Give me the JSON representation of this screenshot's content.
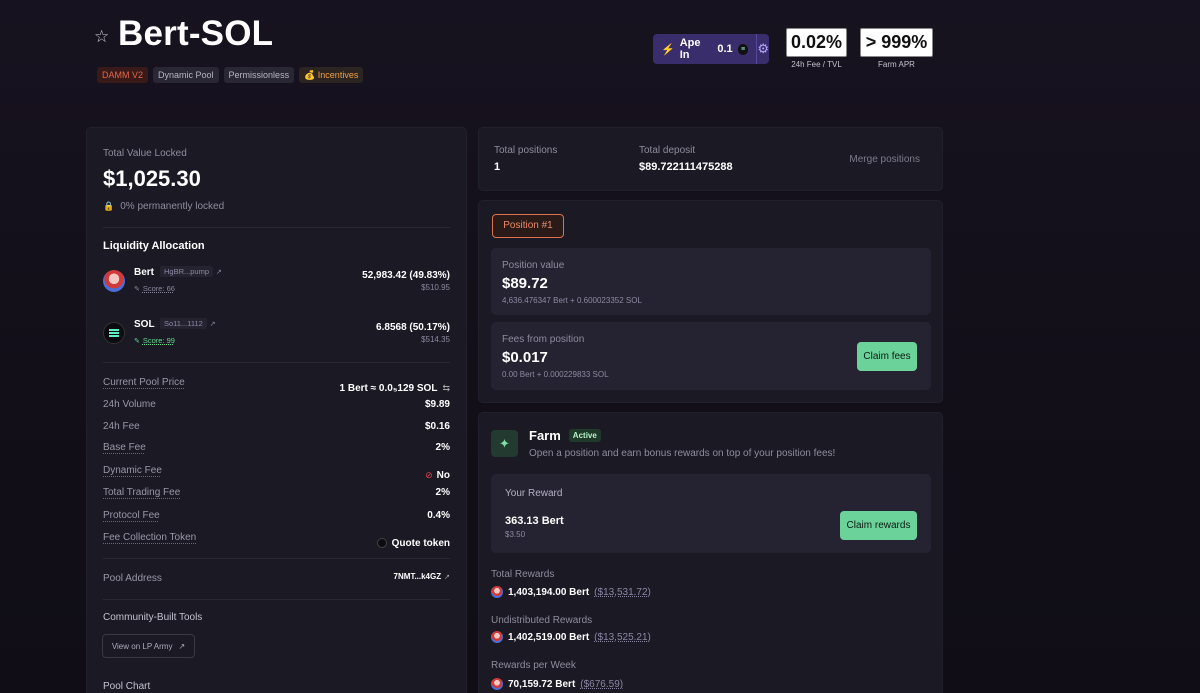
{
  "header": {
    "title": "Bert-SOL",
    "tags": [
      "DAMM V2",
      "Dynamic Pool",
      "Permissionless",
      "Incentives"
    ],
    "ape_label": "Ape In",
    "ape_amount": "0.1",
    "fee_tvl_value": "0.02%",
    "fee_tvl_caption": "24h Fee / TVL",
    "farm_apr_value": "> 999%",
    "farm_apr_caption": "Farm APR"
  },
  "left": {
    "tvl_label": "Total Value Locked",
    "tvl_value": "$1,025.30",
    "locked_text": "0% permanently locked",
    "alloc_title": "Liquidity Allocation",
    "tokens": [
      {
        "symbol": "Bert",
        "address": "HgBR...pump",
        "score": "Score: 66",
        "amount": "52,983.42 (49.83%)",
        "usd": "$510.95"
      },
      {
        "symbol": "SOL",
        "address": "So11...1112",
        "score": "Score: 99",
        "amount": "6.8568 (50.17%)",
        "usd": "$514.35"
      }
    ],
    "rows": [
      {
        "label": "Current Pool Price",
        "value": "1 Bert ≈ 0.0₅129 SOL"
      },
      {
        "label": "24h Volume",
        "value": "$9.89"
      },
      {
        "label": "24h Fee",
        "value": "$0.16"
      },
      {
        "label": "Base Fee",
        "value": "2%"
      },
      {
        "label": "Dynamic Fee",
        "value": "No"
      },
      {
        "label": "Total Trading Fee",
        "value": "2%"
      },
      {
        "label": "Protocol Fee",
        "value": "0.4%"
      },
      {
        "label": "Fee Collection Token",
        "value": "Quote token"
      }
    ],
    "pool_address_label": "Pool Address",
    "pool_address_value": "7NMT...k4GZ",
    "community_title": "Community-Built Tools",
    "lp_army_button": "View on LP Army",
    "pool_chart_title": "Pool Chart"
  },
  "positions_summary": {
    "total_positions_label": "Total positions",
    "total_positions_value": "1",
    "total_deposit_label": "Total deposit",
    "total_deposit_value": "$89.722111475288",
    "merge_label": "Merge positions"
  },
  "position": {
    "badge": "Position #1",
    "value_label": "Position value",
    "value": "$89.72",
    "value_detail": "4,636.476347 Bert + 0.600023352 SOL",
    "fees_label": "Fees from position",
    "fees_value": "$0.017",
    "fees_detail": "0.00 Bert + 0.000229833 SOL",
    "claim_fees": "Claim fees"
  },
  "farm": {
    "title": "Farm",
    "status": "Active",
    "description": "Open a position and earn bonus rewards on top of your position fees!",
    "your_reward_label": "Your Reward",
    "your_reward_value": "363.13 Bert",
    "your_reward_usd": "$3.50",
    "claim_rewards": "Claim rewards",
    "total_rewards_label": "Total Rewards",
    "total_rewards_amount": "1,403,194.00 Bert",
    "total_rewards_usd": "($13,531.72)",
    "undistributed_label": "Undistributed Rewards",
    "undistributed_amount": "1,402,519.00 Bert",
    "undistributed_usd": "($13,525.21)",
    "per_week_label": "Rewards per Week",
    "per_week_amount": "70,159.72 Bert",
    "per_week_usd": "($676.59)"
  }
}
